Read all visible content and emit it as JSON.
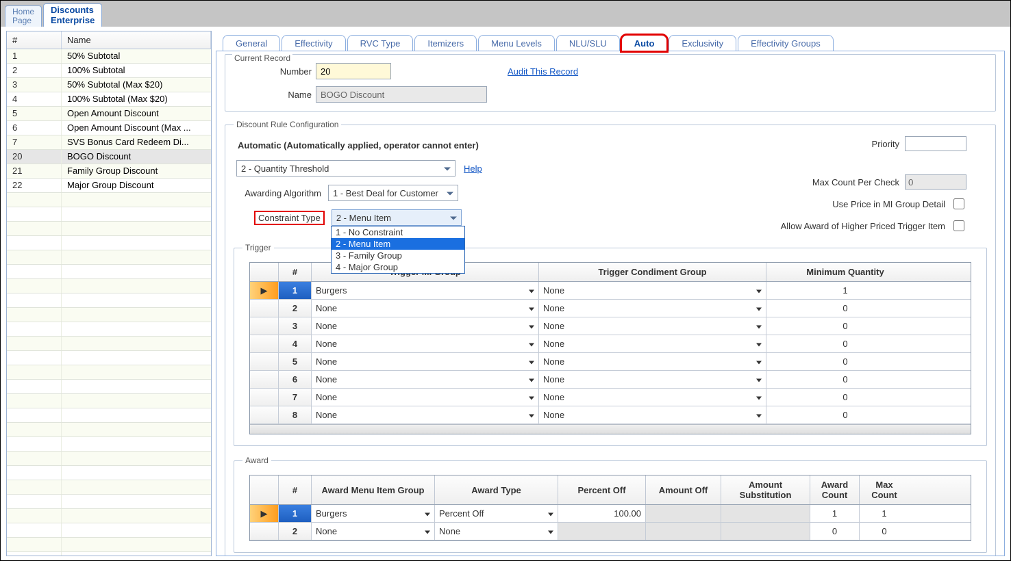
{
  "top_tabs": {
    "home": {
      "line1": "Home",
      "line2": "Page"
    },
    "discounts": {
      "line1": "Discounts",
      "line2": "Enterprise"
    }
  },
  "left_grid": {
    "col_num": "#",
    "col_name": "Name",
    "rows": [
      {
        "num": "1",
        "name": "50% Subtotal"
      },
      {
        "num": "2",
        "name": "100% Subtotal"
      },
      {
        "num": "3",
        "name": "50% Subtotal (Max $20)"
      },
      {
        "num": "4",
        "name": "100% Subtotal (Max $20)"
      },
      {
        "num": "5",
        "name": "Open Amount Discount"
      },
      {
        "num": "6",
        "name": "Open Amount Discount (Max ..."
      },
      {
        "num": "7",
        "name": "SVS Bonus Card Redeem Di..."
      },
      {
        "num": "20",
        "name": "BOGO Discount",
        "selected": true
      },
      {
        "num": "21",
        "name": "Family Group Discount"
      },
      {
        "num": "22",
        "name": "Major Group Discount"
      }
    ]
  },
  "right_tabs": [
    "General",
    "Effectivity",
    "RVC Type",
    "Itemizers",
    "Menu Levels",
    "NLU/SLU",
    "Auto",
    "Exclusivity",
    "Effectivity Groups"
  ],
  "right_tabs_active_index": 6,
  "current_record": {
    "legend": "Current Record",
    "number_label": "Number",
    "number_value": "20",
    "name_label": "Name",
    "name_value": "BOGO Discount",
    "audit_link": "Audit This Record"
  },
  "rule": {
    "legend": "Discount Rule Configuration",
    "mode_text": "Automatic (Automatically applied, operator cannot enter)",
    "priority_label": "Priority",
    "priority_value": "",
    "threshold_value": "2 - Quantity Threshold",
    "help_link": "Help",
    "awarding_label": "Awarding Algorithm",
    "awarding_value": "1 - Best Deal for Customer",
    "constraint_label": "Constraint Type",
    "constraint_value": "2 - Menu Item",
    "constraint_options": [
      "1 - No Constraint",
      "2 - Menu Item",
      "3 - Family Group",
      "4 - Major Group"
    ],
    "max_count_label": "Max Count Per Check",
    "max_count_value": "0",
    "use_price_label": "Use Price in MI Group Detail",
    "allow_higher_label": "Allow Award of Higher Priced Trigger Item"
  },
  "trigger": {
    "legend": "Trigger",
    "col_num": "#",
    "col_group": "Trigger MI Group",
    "col_cond": "Trigger Condiment Group",
    "col_min": "Minimum Quantity",
    "rows": [
      {
        "n": "1",
        "group": "Burgers",
        "cond": "None",
        "min": "1",
        "selected": true
      },
      {
        "n": "2",
        "group": "None",
        "cond": "None",
        "min": "0"
      },
      {
        "n": "3",
        "group": "None",
        "cond": "None",
        "min": "0"
      },
      {
        "n": "4",
        "group": "None",
        "cond": "None",
        "min": "0"
      },
      {
        "n": "5",
        "group": "None",
        "cond": "None",
        "min": "0"
      },
      {
        "n": "6",
        "group": "None",
        "cond": "None",
        "min": "0"
      },
      {
        "n": "7",
        "group": "None",
        "cond": "None",
        "min": "0"
      },
      {
        "n": "8",
        "group": "None",
        "cond": "None",
        "min": "0"
      }
    ]
  },
  "award": {
    "legend": "Award",
    "col_num": "#",
    "col_group": "Award Menu Item Group",
    "col_type": "Award Type",
    "col_pct": "Percent Off",
    "col_amt": "Amount Off",
    "col_sub": "Amount Substitution",
    "col_cnt": "Award Count",
    "col_max": "Max Count",
    "rows": [
      {
        "n": "1",
        "group": "Burgers",
        "type": "Percent Off",
        "pct": "100.00",
        "amt": "",
        "sub": "",
        "cnt": "1",
        "max": "1",
        "selected": true
      },
      {
        "n": "2",
        "group": "None",
        "type": "None",
        "pct": "",
        "amt": "",
        "sub": "",
        "cnt": "0",
        "max": "0"
      }
    ]
  }
}
